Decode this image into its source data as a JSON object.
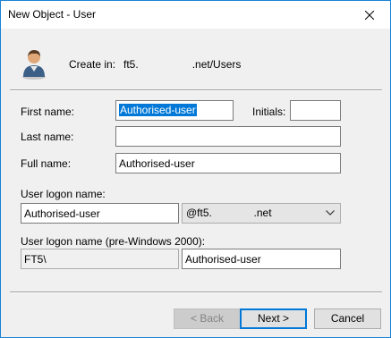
{
  "window": {
    "title": "New Object - User"
  },
  "header": {
    "create_in_label": "Create in:",
    "create_in_path": "ft5.                  .net/Users"
  },
  "form": {
    "first_name_label": "First name:",
    "first_name_value": "Authorised-user",
    "initials_label": "Initials:",
    "initials_value": "",
    "last_name_label": "Last name:",
    "last_name_value": "",
    "full_name_label": "Full name:",
    "full_name_value": "Authorised-user",
    "logon_name_label": "User logon name:",
    "logon_name_value": "Authorised-user",
    "domain_suffix": "@ft5.              .net",
    "pre2000_label": "User logon name (pre-Windows 2000):",
    "pre2000_domain": "FT5\\",
    "pre2000_value": "Authorised-user"
  },
  "buttons": {
    "back": "< Back",
    "next": "Next >",
    "cancel": "Cancel"
  },
  "colors": {
    "accent": "#0078d7",
    "border": "#1883d7",
    "background": "#f0f0f0"
  }
}
